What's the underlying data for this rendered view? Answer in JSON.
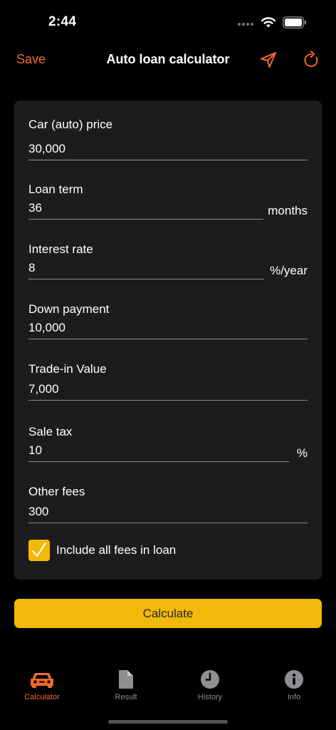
{
  "status": {
    "time": "2:44"
  },
  "nav": {
    "save_label": "Save",
    "title": "Auto loan calculator"
  },
  "form": {
    "car_price": {
      "label": "Car (auto) price",
      "value": "30,000"
    },
    "loan_term": {
      "label": "Loan term",
      "value": "36",
      "unit": "months"
    },
    "interest_rate": {
      "label": "Interest rate",
      "value": "8",
      "unit": "%/year"
    },
    "down_payment": {
      "label": "Down payment",
      "value": "10,000"
    },
    "trade_in": {
      "label": "Trade-in Value",
      "value": "7,000"
    },
    "sale_tax": {
      "label": "Sale tax",
      "value": "10",
      "unit": "%"
    },
    "other_fees": {
      "label": "Other fees",
      "value": "300"
    },
    "include_fees": {
      "label": "Include all fees in loan",
      "checked": true
    }
  },
  "calculate_label": "Calculate",
  "tabs": [
    {
      "label": "Calculator",
      "icon": "car-icon",
      "active": true
    },
    {
      "label": "Result",
      "icon": "document-icon",
      "active": false
    },
    {
      "label": "History",
      "icon": "clock-icon",
      "active": false
    },
    {
      "label": "Info",
      "icon": "info-icon",
      "active": false
    }
  ],
  "colors": {
    "accent": "#f26a2c",
    "button": "#f2b90d",
    "card": "#1c1c1e",
    "inactive": "#8e8e93"
  }
}
